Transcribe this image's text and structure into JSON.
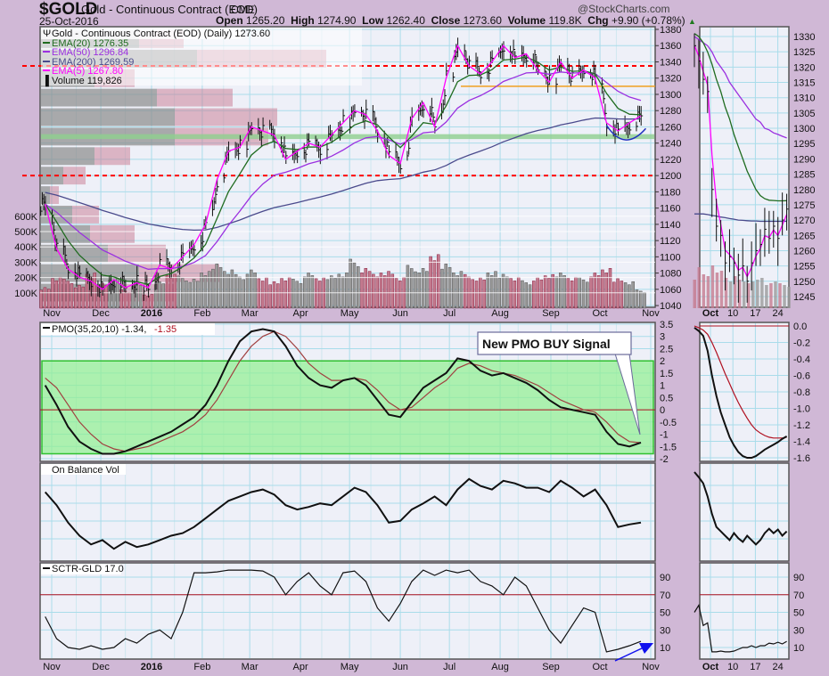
{
  "header": {
    "symbol": "$GOLD",
    "name": "Gold - Continuous Contract (EOD)",
    "exchange": "CME",
    "date": "25-Oct-2016",
    "watermark": "@StockCharts.com",
    "open_label": "Open",
    "open": "1265.20",
    "high_label": "High",
    "high": "1274.90",
    "low_label": "Low",
    "low": "1262.40",
    "close_label": "Close",
    "close": "1273.60",
    "volume_label": "Volume",
    "volume": "119.8K",
    "chg_label": "Chg",
    "chg": "+9.90 (+0.78%)",
    "chg_icon": "up-triangle-icon"
  },
  "legend": {
    "title": "Gold - Continuous Contract (EOD) (Daily) 1273.60",
    "ema20": "EMA(20) 1276.35",
    "ema50": "EMA(50) 1296.84",
    "ema200": "EMA(200) 1269.59",
    "ema5": "EMA(5) 1267.80",
    "volume": "Volume 119,826",
    "pmo": "PMO(35,20,10) -1.34,",
    "pmo_signal": "-1.35",
    "obv": "On Balance Vol",
    "sctr": "SCTR-GLD 17.0"
  },
  "colors": {
    "background": "#d0b8d6",
    "panel": "#eef0f8",
    "grid": "#a9dcea",
    "ema20": "#1f6b1f",
    "ema50": "#9b30e0",
    "ema200": "#4a4a8c",
    "ema5": "#ff00ff",
    "resistance": "#ff0000",
    "orange_line": "#f0a020",
    "support_band": "#8fd08f",
    "pmo_zone": "#90f090",
    "signal": "#b01020",
    "arrow": "#1010ee"
  },
  "annotation": {
    "text": "New PMO BUY Signal"
  },
  "chart_data": {
    "type": "line",
    "title": "$GOLD Gold - Continuous Contract (EOD) Daily",
    "x_unit": "days since 1-Nov-2015 (weekly samples)",
    "month_labels": [
      "Nov",
      "Dec",
      "2016",
      "Feb",
      "Mar",
      "Apr",
      "May",
      "Jun",
      "Jul",
      "Aug",
      "Sep",
      "Oct",
      "Nov"
    ],
    "month_start_day": [
      0,
      30,
      61,
      92,
      121,
      152,
      182,
      213,
      243,
      274,
      305,
      335,
      366
    ],
    "price_ticks": [
      1380,
      1360,
      1340,
      1320,
      1300,
      1280,
      1260,
      1240,
      1220,
      1200,
      1180,
      1160,
      1140,
      1120,
      1100,
      1080,
      1060,
      1040
    ],
    "ylim": [
      1040,
      1380
    ],
    "volume_ticks": [
      "600K",
      "500K",
      "400K",
      "300K",
      "200K",
      "100K"
    ],
    "volume_tick_values": [
      600,
      500,
      400,
      300,
      200,
      100
    ],
    "close": [
      1165,
      1110,
      1085,
      1075,
      1070,
      1060,
      1072,
      1062,
      1068,
      1062,
      1090,
      1085,
      1100,
      1115,
      1140,
      1195,
      1230,
      1235,
      1260,
      1255,
      1250,
      1220,
      1230,
      1240,
      1235,
      1250,
      1265,
      1280,
      1275,
      1255,
      1225,
      1215,
      1270,
      1290,
      1260,
      1320,
      1360,
      1335,
      1325,
      1340,
      1360,
      1345,
      1350,
      1330,
      1315,
      1340,
      1320,
      1330,
      1320,
      1265,
      1255,
      1265,
      1273.6
    ],
    "volume_k": [
      140,
      210,
      190,
      150,
      230,
      170,
      200,
      120,
      160,
      90,
      180,
      230,
      210,
      190,
      240,
      300,
      260,
      220,
      250,
      200,
      180,
      210,
      190,
      230,
      200,
      220,
      240,
      320,
      260,
      230,
      250,
      210,
      280,
      260,
      350,
      300,
      250,
      220,
      200,
      240,
      230,
      210,
      180,
      200,
      220,
      240,
      210,
      200,
      230,
      260,
      200,
      180,
      120
    ],
    "ema200_seed": 1180,
    "ema_periods_weekly": {
      "ema5": 1,
      "ema20": 4,
      "ema50": 10,
      "ema200": 40
    },
    "volume_by_price": [
      {
        "band": [
          1356,
          1380
        ],
        "up": 110,
        "down": 50
      },
      {
        "band": [
          1332,
          1356
        ],
        "up": 175,
        "down": 145
      },
      {
        "band": [
          1308,
          1332
        ],
        "up": 60,
        "down": 45
      },
      {
        "band": [
          1284,
          1308
        ],
        "up": 130,
        "down": 85
      },
      {
        "band": [
          1260,
          1284
        ],
        "up": 150,
        "down": 115
      },
      {
        "band": [
          1236,
          1260
        ],
        "up": 150,
        "down": 105
      },
      {
        "band": [
          1212,
          1236
        ],
        "up": 60,
        "down": 40
      },
      {
        "band": [
          1188,
          1212
        ],
        "up": 25,
        "down": 25
      },
      {
        "band": [
          1164,
          1188
        ],
        "up": 10,
        "down": 10
      },
      {
        "band": [
          1140,
          1164
        ],
        "up": 35,
        "down": 30
      },
      {
        "band": [
          1116,
          1140
        ],
        "up": 55,
        "down": 50
      },
      {
        "band": [
          1092,
          1116
        ],
        "up": 75,
        "down": 65
      },
      {
        "band": [
          1068,
          1092
        ],
        "up": 110,
        "down": 90
      },
      {
        "band": [
          1044,
          1068
        ],
        "up": 90,
        "down": 60
      }
    ],
    "levels": {
      "resistance_upper": 1335,
      "resistance_lower": 1200,
      "orange": 1310,
      "support_band": [
        1245,
        1251
      ]
    },
    "pmo": {
      "ticks": [
        3.5,
        3.0,
        2.5,
        2.0,
        1.5,
        1.0,
        0.5,
        0.0,
        -0.5,
        -1.0,
        -1.5,
        -2.0
      ],
      "ylim": [
        -2.0,
        3.5
      ],
      "zone": [
        -1.8,
        2.0
      ],
      "values": [
        1.0,
        0.2,
        -0.7,
        -1.3,
        -1.6,
        -1.8,
        -1.8,
        -1.7,
        -1.5,
        -1.3,
        -1.1,
        -0.9,
        -0.6,
        -0.3,
        0.2,
        1.0,
        2.0,
        2.8,
        3.2,
        3.3,
        3.2,
        2.6,
        1.8,
        1.3,
        1.0,
        0.9,
        1.2,
        1.3,
        1.0,
        0.4,
        -0.2,
        -0.3,
        0.3,
        0.9,
        1.2,
        1.5,
        2.1,
        2.0,
        1.6,
        1.4,
        1.5,
        1.3,
        1.1,
        0.8,
        0.4,
        0.1,
        0.0,
        -0.1,
        -0.2,
        -0.9,
        -1.4,
        -1.5,
        -1.34
      ],
      "signal": [
        1.3,
        0.9,
        0.2,
        -0.5,
        -1.0,
        -1.4,
        -1.6,
        -1.7,
        -1.6,
        -1.5,
        -1.3,
        -1.1,
        -0.9,
        -0.6,
        -0.2,
        0.4,
        1.2,
        2.0,
        2.6,
        3.0,
        3.2,
        3.0,
        2.5,
        1.9,
        1.5,
        1.2,
        1.2,
        1.3,
        1.2,
        0.8,
        0.3,
        0.0,
        0.1,
        0.5,
        0.9,
        1.2,
        1.7,
        1.9,
        1.8,
        1.6,
        1.5,
        1.4,
        1.2,
        1.0,
        0.7,
        0.4,
        0.2,
        0.0,
        -0.1,
        -0.5,
        -1.0,
        -1.3,
        -1.35
      ]
    },
    "obv_relative": [
      75,
      60,
      40,
      25,
      15,
      20,
      10,
      18,
      12,
      15,
      20,
      25,
      28,
      35,
      45,
      55,
      65,
      70,
      75,
      78,
      72,
      60,
      55,
      58,
      62,
      60,
      70,
      80,
      75,
      60,
      40,
      42,
      55,
      62,
      70,
      60,
      78,
      90,
      82,
      78,
      88,
      85,
      80,
      80,
      75,
      88,
      80,
      70,
      78,
      60,
      35,
      38,
      40
    ],
    "sctr": {
      "ticks": [
        90,
        70,
        50,
        30,
        10
      ],
      "ylim": [
        0,
        100
      ],
      "reference": 70,
      "values": [
        45,
        20,
        10,
        8,
        12,
        8,
        10,
        20,
        15,
        25,
        30,
        20,
        50,
        95,
        95,
        96,
        98,
        98,
        98,
        97,
        90,
        70,
        85,
        95,
        80,
        70,
        95,
        97,
        85,
        55,
        40,
        60,
        85,
        98,
        92,
        98,
        95,
        98,
        85,
        80,
        70,
        90,
        80,
        55,
        30,
        15,
        35,
        55,
        50,
        5,
        8,
        12,
        17
      ]
    },
    "zoom": {
      "day_labels": [
        "Oct",
        "10",
        "17",
        "24"
      ],
      "day_label_offsets": [
        3,
        10,
        17,
        24
      ],
      "start_day": -2,
      "price_ticks": [
        1330,
        1325,
        1320,
        1315,
        1310,
        1305,
        1300,
        1295,
        1290,
        1285,
        1280,
        1275,
        1270,
        1265,
        1260,
        1255,
        1250,
        1245
      ],
      "ylim": [
        1242,
        1332
      ],
      "close": [
        1327,
        1322,
        1316,
        1312,
        1280,
        1268,
        1265,
        1256,
        1258,
        1256,
        1252,
        1255,
        1250,
        1256,
        1260,
        1262,
        1267,
        1264,
        1268,
        1264,
        1270,
        1273.6
      ],
      "ema20": [
        1331,
        1330,
        1328,
        1325,
        1321,
        1316,
        1312,
        1307,
        1303,
        1298,
        1294,
        1290,
        1286,
        1283,
        1280,
        1278,
        1277,
        1276.5,
        1276.4,
        1276.3,
        1276.3,
        1276.35
      ],
      "ema50": [
        1330,
        1329,
        1328,
        1327,
        1325,
        1322,
        1320,
        1318,
        1315,
        1313,
        1311,
        1309,
        1307,
        1305,
        1303,
        1302,
        1300,
        1299.5,
        1298.5,
        1298,
        1297.4,
        1296.84
      ],
      "ema200": [
        1272,
        1272,
        1272,
        1271.8,
        1271.5,
        1271.3,
        1271,
        1270.8,
        1270.5,
        1270.3,
        1270,
        1269.9,
        1269.8,
        1269.7,
        1269.7,
        1269.6,
        1269.6,
        1269.6,
        1269.6,
        1269.6,
        1269.6,
        1269.59
      ],
      "volume_k": [
        160,
        230,
        190,
        180,
        240,
        200,
        210,
        170,
        150,
        180,
        160,
        150,
        140,
        150,
        160,
        170,
        130,
        140,
        150,
        140,
        130,
        120
      ],
      "pmo_ticks": [
        "0.0",
        "-0.2",
        "-0.4",
        "-0.6",
        "-0.8",
        "-1.0",
        "-1.2",
        "-1.4",
        "-1.6"
      ],
      "pmo_tick_values": [
        0.0,
        -0.2,
        -0.4,
        -0.6,
        -0.8,
        -1.0,
        -1.2,
        -1.4,
        -1.6
      ],
      "pmo": [
        -0.02,
        -0.06,
        -0.12,
        -0.3,
        -0.6,
        -0.85,
        -1.05,
        -1.2,
        -1.35,
        -1.45,
        -1.53,
        -1.58,
        -1.6,
        -1.6,
        -1.58,
        -1.54,
        -1.5,
        -1.47,
        -1.44,
        -1.41,
        -1.37,
        -1.34
      ],
      "pmo_signal": [
        0.0,
        -0.02,
        -0.05,
        -0.1,
        -0.2,
        -0.32,
        -0.45,
        -0.58,
        -0.7,
        -0.82,
        -0.93,
        -1.03,
        -1.12,
        -1.2,
        -1.26,
        -1.3,
        -1.33,
        -1.35,
        -1.36,
        -1.36,
        -1.36,
        -1.35
      ],
      "obv_relative": [
        98,
        92,
        85,
        70,
        50,
        35,
        30,
        25,
        20,
        28,
        22,
        18,
        25,
        20,
        15,
        20,
        28,
        33,
        28,
        32,
        25,
        30
      ],
      "sctr": [
        50,
        58,
        35,
        38,
        5,
        5,
        6,
        5,
        5,
        6,
        8,
        10,
        10,
        12,
        10,
        12,
        12,
        15,
        14,
        16,
        14,
        17
      ]
    }
  }
}
